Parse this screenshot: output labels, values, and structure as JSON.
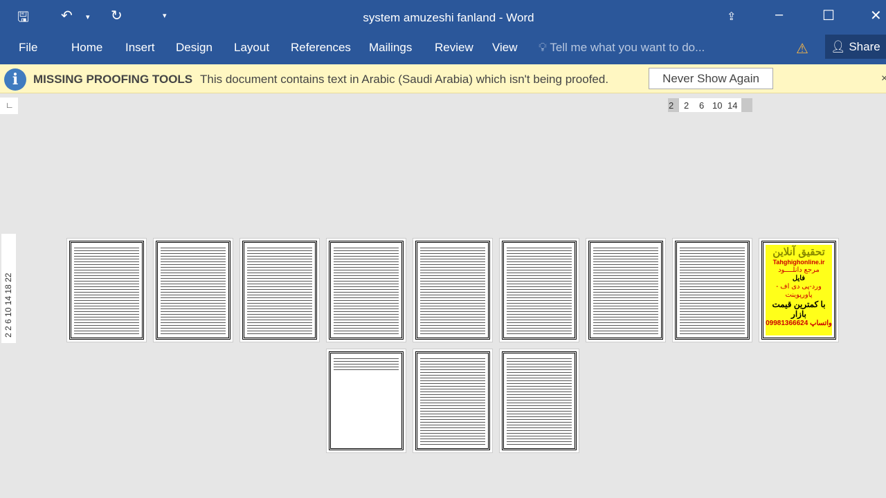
{
  "window": {
    "title": "system amuzeshi fanland - Word"
  },
  "quick_access": {
    "save_icon": "save-icon",
    "undo_icon": "undo-icon",
    "redo_icon": "redo-icon",
    "customize_icon": "customize-qat-icon"
  },
  "ribbon": {
    "tabs": [
      "File",
      "Home",
      "Insert",
      "Design",
      "Layout",
      "References",
      "Mailings",
      "Review",
      "View"
    ],
    "tell_me": "Tell me what you want to do...",
    "share": "Share"
  },
  "message_bar": {
    "title": "MISSING PROOFING TOOLS",
    "message": "This document contains text in Arabic (Saudi Arabia) which isn't being proofed.",
    "button": "Never Show Again",
    "close": "×"
  },
  "ruler": {
    "horizontal": [
      "2",
      "2",
      "6",
      "10",
      "14"
    ],
    "vertical": "2 2 6 10 14 18 22"
  },
  "ad_page": {
    "line1": "تحقیق آنلاین",
    "line2": "Tahghighonline.ir",
    "line3": "مرجع دانلــــود",
    "line4": "فایل",
    "line5": "ورد-پی دی اف - پاورپوینت",
    "line6": "با کمترین قیمت بازار",
    "line7": "09981366624 واتساپ"
  },
  "colors": {
    "ribbon": "#2b579a",
    "message_bar": "#fff7c2"
  }
}
